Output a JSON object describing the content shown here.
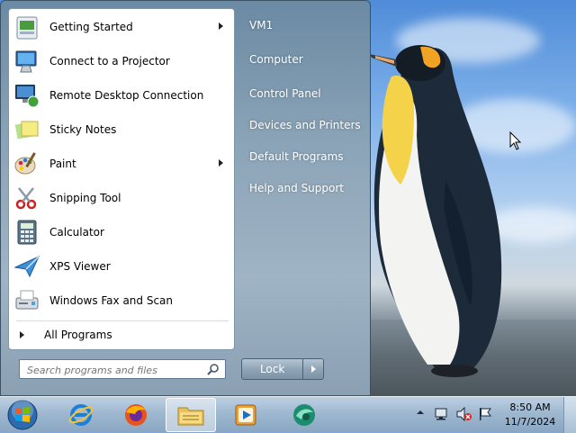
{
  "start_menu": {
    "programs": [
      {
        "label": "Getting Started",
        "icon": "getting-started-icon",
        "submenu": true
      },
      {
        "label": "Connect to a Projector",
        "icon": "projector-icon",
        "submenu": false
      },
      {
        "label": "Remote Desktop Connection",
        "icon": "remote-desktop-icon",
        "submenu": false
      },
      {
        "label": "Sticky Notes",
        "icon": "sticky-notes-icon",
        "submenu": false
      },
      {
        "label": "Paint",
        "icon": "paint-icon",
        "submenu": true
      },
      {
        "label": "Snipping Tool",
        "icon": "snipping-tool-icon",
        "submenu": false
      },
      {
        "label": "Calculator",
        "icon": "calculator-icon",
        "submenu": false
      },
      {
        "label": "XPS Viewer",
        "icon": "xps-viewer-icon",
        "submenu": false
      },
      {
        "label": "Windows Fax and Scan",
        "icon": "fax-scan-icon",
        "submenu": false
      }
    ],
    "all_programs": "All Programs",
    "search_placeholder": "Search programs and files",
    "right_items": [
      "VM1",
      "Computer",
      "Control Panel",
      "Devices and Printers",
      "Default Programs",
      "Help and Support"
    ],
    "lock_label": "Lock"
  },
  "taskbar": {
    "buttons": [
      "start-orb",
      "internet-explorer-icon",
      "firefox-icon",
      "file-explorer-icon",
      "media-player-icon",
      "app-icon"
    ],
    "active_button": "file-explorer-icon",
    "tray_icons": [
      "show-hidden-icons",
      "network-icon",
      "volume-muted-icon",
      "action-center-flag-icon"
    ],
    "time": "8:50 AM",
    "date": "11/7/2024"
  }
}
